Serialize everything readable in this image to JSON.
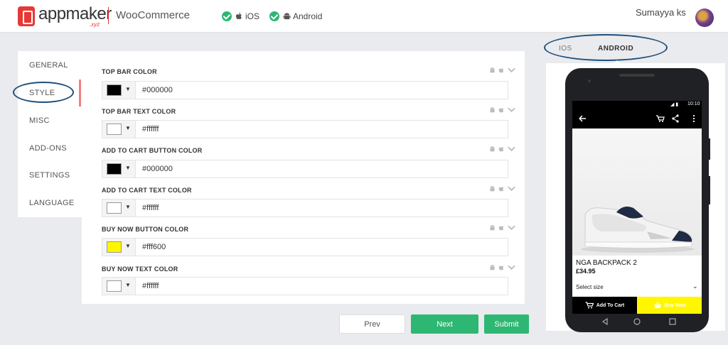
{
  "header": {
    "logo_text": "appmaker",
    "logo_sub": ".xyz",
    "platform": "WooCommerce",
    "badges": [
      {
        "label": "iOS"
      },
      {
        "label": "Android"
      }
    ],
    "user_name": "Sumayya ks"
  },
  "sidebar": {
    "items": [
      {
        "label": "GENERAL"
      },
      {
        "label": "STYLE"
      },
      {
        "label": "MISC"
      },
      {
        "label": "ADD-ONS"
      },
      {
        "label": "SETTINGS"
      },
      {
        "label": "LANGUAGE"
      }
    ],
    "active": "STYLE"
  },
  "fields": [
    {
      "label": "TOP BAR COLOR",
      "value": "#000000",
      "swatch": "#000000"
    },
    {
      "label": "TOP BAR TEXT COLOR",
      "value": "#ffffff",
      "swatch": "#ffffff"
    },
    {
      "label": "ADD TO CART BUTTON COLOR",
      "value": "#000000",
      "swatch": "#000000"
    },
    {
      "label": "ADD TO CART TEXT COLOR",
      "value": "#ffffff",
      "swatch": "#ffffff"
    },
    {
      "label": "BUY NOW BUTTON COLOR",
      "value": "#fff600",
      "swatch": "#fff600"
    },
    {
      "label": "BUY NOW TEXT COLOR",
      "value": "#ffffff",
      "swatch": "#ffffff"
    }
  ],
  "buttons": {
    "prev": "Prev",
    "next": "Next",
    "submit": "Submit"
  },
  "preview": {
    "tabs": [
      {
        "label": "IOS"
      },
      {
        "label": "ANDROID"
      }
    ],
    "active_tab": "ANDROID",
    "status_time": "10:10",
    "product_name": "NGA BACKPACK 2",
    "product_price": "£34.95",
    "select_size": "Select size",
    "add_to_cart": "Add To Cart",
    "buy_now": "Buy Now"
  },
  "colors": {
    "accent_green": "#2eb772",
    "brand_red": "#e53935",
    "annotation_blue": "#1f4e79"
  }
}
